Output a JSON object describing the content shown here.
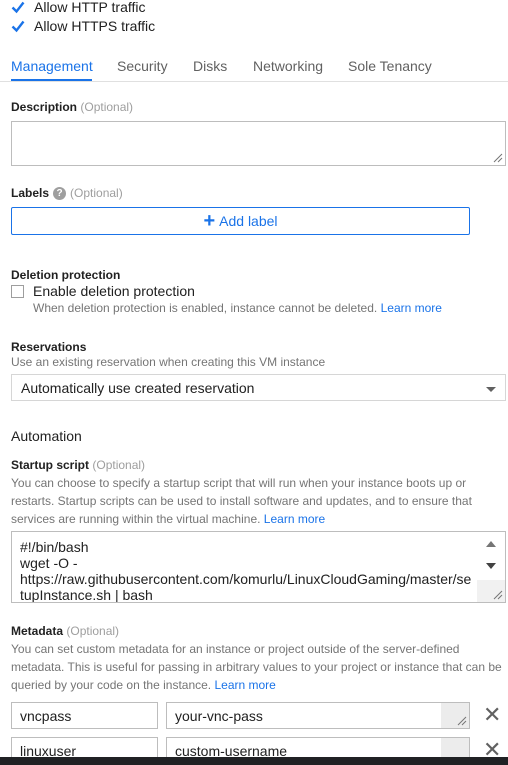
{
  "firewall": {
    "http_label": "Allow HTTP traffic",
    "https_label": "Allow HTTPS traffic"
  },
  "tabs": [
    {
      "label": "Management",
      "active": true
    },
    {
      "label": "Security",
      "active": false
    },
    {
      "label": "Disks",
      "active": false
    },
    {
      "label": "Networking",
      "active": false
    },
    {
      "label": "Sole Tenancy",
      "active": false
    }
  ],
  "description": {
    "label": "Description",
    "optional": "(Optional)",
    "value": ""
  },
  "labels": {
    "label": "Labels",
    "optional": "(Optional)",
    "add_button": "Add label"
  },
  "deletion": {
    "title": "Deletion protection",
    "checkbox_label": "Enable deletion protection",
    "help": "When deletion protection is enabled, instance cannot be deleted.",
    "learn_more": "Learn more"
  },
  "reservations": {
    "title": "Reservations",
    "help": "Use an existing reservation when creating this VM instance",
    "selected": "Automatically use created reservation"
  },
  "automation": {
    "title": "Automation",
    "startup_label": "Startup script",
    "optional": "(Optional)",
    "help": "You can choose to specify a startup script that will run when your instance boots up or restarts. Startup scripts can be used to install software and updates, and to ensure that services are running within the virtual machine.",
    "learn_more": "Learn more",
    "script_lines": [
      "#!/bin/bash",
      "wget -O -",
      "https://raw.githubusercontent.com/komurlu/LinuxCloudGaming/master/se",
      "tupInstance.sh | bash"
    ]
  },
  "metadata": {
    "label": "Metadata",
    "optional": "(Optional)",
    "help": "You can set custom metadata for an instance or project outside of the server-defined metadata. This is useful for passing in arbitrary values to your project or instance that can be queried by your code on the instance.",
    "learn_more": "Learn more",
    "items": [
      {
        "key": "vncpass",
        "value": "your-vnc-pass"
      },
      {
        "key": "linuxuser",
        "value": "custom-username"
      }
    ]
  },
  "colors": {
    "accent": "#1a73e8",
    "text": "#212121",
    "muted": "#757575"
  }
}
